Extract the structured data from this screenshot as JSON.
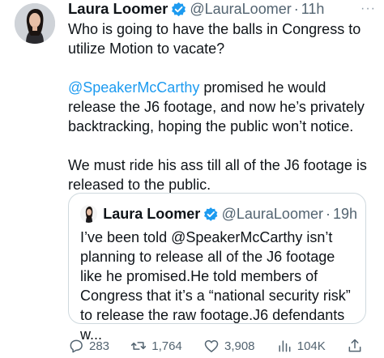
{
  "tweet": {
    "author_name": "Laura Loomer",
    "handle": "@LauraLoomer",
    "separator": "·",
    "time": "11h",
    "more": "···",
    "paragraphs": {
      "p1": "Who is going to have the balls in Congress to utilize Motion to vacate?",
      "p2_mention": "@SpeakerMcCarthy",
      "p2_rest": " promised he would release the J6 footage, and now he’s privately backtracking, hoping the public won’t notice.",
      "p3": "We must ride his ass till all of the J6 footage is released to the public."
    }
  },
  "quoted": {
    "author_name": "Laura Loomer",
    "handle": "@LauraLoomer",
    "separator": "·",
    "time": "19h",
    "text": "I’ve been told @SpeakerMcCarthy isn’t planning to release all of the J6 footage like he promised.He told members of Congress that it’s a “national security risk” to release the raw footage.J6 defendants w..."
  },
  "actions": {
    "replies": "283",
    "reposts": "1,764",
    "likes": "3,908",
    "views": "104K"
  },
  "colors": {
    "text": "#0f1419",
    "secondary": "#536471",
    "link": "#1d9bf0",
    "verified": "#1d9bf0",
    "border": "#cfd9de"
  }
}
